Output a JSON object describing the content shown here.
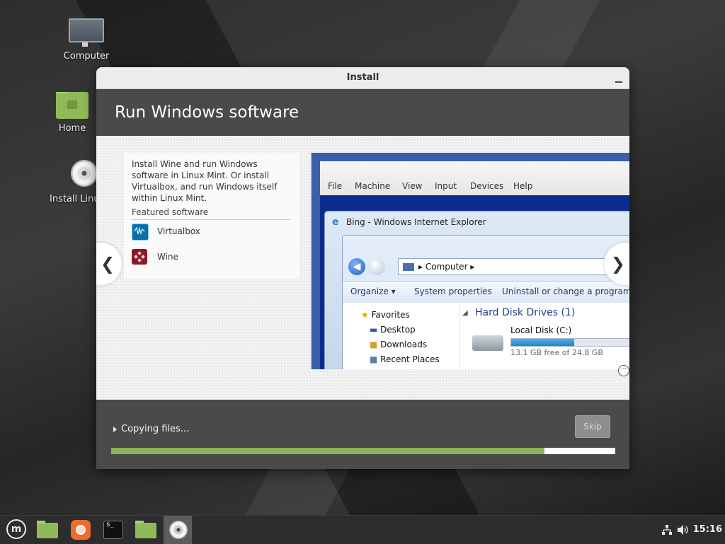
{
  "desktop": {
    "icons": [
      {
        "label": "Computer"
      },
      {
        "label": "Home"
      },
      {
        "label": "Install Linux Mint"
      }
    ]
  },
  "window": {
    "title": "Install",
    "header": "Run Windows software",
    "description": "Install Wine and run Windows software in Linux Mint. Or install Virtualbox, and run Windows itself within Linux Mint.",
    "featured_title": "Featured software",
    "software": [
      {
        "name": "Virtualbox",
        "icon": "virtualbox-icon"
      },
      {
        "name": "Wine",
        "icon": "wine-icon"
      }
    ],
    "slideshow": {
      "prev_glyph": "❮",
      "next_glyph": "❯",
      "vbox_menu": [
        "File",
        "Machine",
        "View",
        "Input",
        "Devices",
        "Help"
      ],
      "ie_title": "Bing - Windows Internet Explorer",
      "address": "Computer",
      "explorer_toolbar": [
        "Organize ▾",
        "System properties",
        "Uninstall or change a program"
      ],
      "nav_items": [
        "Favorites",
        "Desktop",
        "Downloads",
        "Recent Places"
      ],
      "drives_title": "Hard Disk Drives (1)",
      "disk_name": "Local Disk (C:)",
      "disk_free": "13.1 GB free of 24.8 GB",
      "disk_used_fraction": 0.47
    },
    "status_text": "Copying files...",
    "skip_label": "Skip",
    "progress": 0.86
  },
  "taskbar": {
    "clock": "15:16",
    "apps": [
      "menu-icon",
      "show-desktop-icon",
      "firefox-icon",
      "terminal-icon",
      "files-icon",
      "installer-icon"
    ]
  },
  "colors": {
    "accent": "#8fb25f",
    "header_bg": "#4a4a4a",
    "folder": "#8fba57"
  }
}
